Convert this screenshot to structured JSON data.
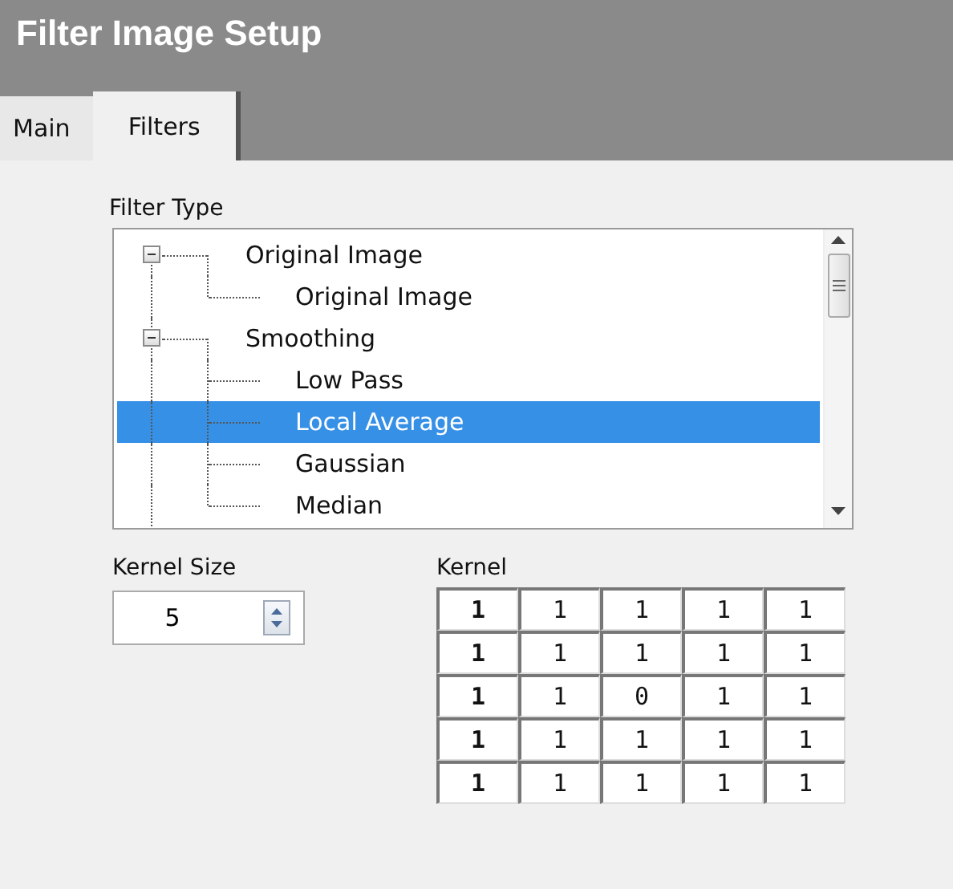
{
  "window": {
    "title": "Filter Image Setup"
  },
  "tabs": [
    {
      "label": "Main",
      "selected": false
    },
    {
      "label": "Filters",
      "selected": true
    }
  ],
  "filter_type": {
    "label": "Filter Type",
    "tree": [
      {
        "label": "Original Image",
        "expanded": true,
        "children": [
          {
            "label": "Original Image",
            "selected": false
          }
        ]
      },
      {
        "label": "Smoothing",
        "expanded": true,
        "children": [
          {
            "label": "Low Pass",
            "selected": false
          },
          {
            "label": "Local Average",
            "selected": true
          },
          {
            "label": "Gaussian",
            "selected": false
          },
          {
            "label": "Median",
            "selected": false
          }
        ]
      }
    ]
  },
  "kernel_size": {
    "label": "Kernel Size",
    "value": "5"
  },
  "kernel": {
    "label": "Kernel",
    "rows": [
      [
        "1",
        "1",
        "1",
        "1",
        "1"
      ],
      [
        "1",
        "1",
        "1",
        "1",
        "1"
      ],
      [
        "1",
        "1",
        "0",
        "1",
        "1"
      ],
      [
        "1",
        "1",
        "1",
        "1",
        "1"
      ],
      [
        "1",
        "1",
        "1",
        "1",
        "1"
      ]
    ]
  }
}
